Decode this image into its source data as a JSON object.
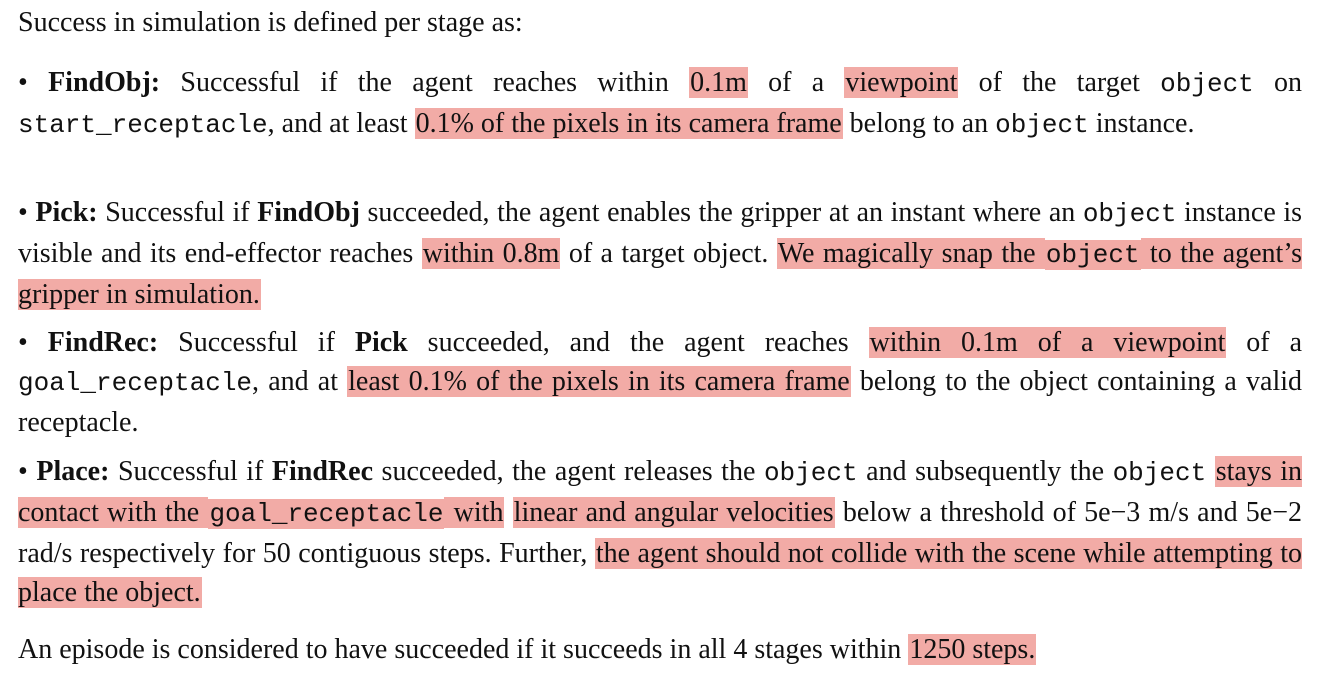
{
  "intro": "Success in simulation is defined per stage as:",
  "highlight_color": "#f2aba6",
  "stages": [
    {
      "name": "FindObj:",
      "segments": [
        {
          "t": "Successful if the agent reaches within "
        },
        {
          "t": "0.1m",
          "h": true
        },
        {
          "t": " of a "
        },
        {
          "t": "viewpoint",
          "h": true
        },
        {
          "t": " of the target "
        },
        {
          "t": "object",
          "m": true
        },
        {
          "t": " on "
        },
        {
          "t": "start_receptacle",
          "m": true
        },
        {
          "t": ", and at least "
        },
        {
          "t": "0.1% of the pixels in its camera frame",
          "h": true
        },
        {
          "t": " belong to an "
        },
        {
          "t": "object",
          "m": true
        },
        {
          "t": " instance."
        }
      ]
    },
    {
      "name": "Pick:",
      "segments": [
        {
          "t": "Successful if "
        },
        {
          "t": "FindObj",
          "b": true
        },
        {
          "t": " succeeded, the agent enables the gripper at an instant where an "
        },
        {
          "t": "object",
          "m": true
        },
        {
          "t": " instance is visible and its end-effector reaches "
        },
        {
          "t": "within 0.8m",
          "h": true
        },
        {
          "t": " of a target object. "
        },
        {
          "t": "We magically snap the ",
          "h": true
        },
        {
          "t": "object",
          "m": true,
          "h": true
        },
        {
          "t": " to the agent’s gripper in simulation.",
          "h": true
        }
      ]
    },
    {
      "name": "FindRec:",
      "segments": [
        {
          "t": "Successful if "
        },
        {
          "t": "Pick",
          "b": true
        },
        {
          "t": " succeeded, and the agent reaches "
        },
        {
          "t": "within 0.1m of a viewpoint",
          "h": true
        },
        {
          "t": " of a "
        },
        {
          "t": "goal_receptacle",
          "m": true
        },
        {
          "t": ", and at "
        },
        {
          "t": "least 0.1% of the pixels in its camera frame",
          "h": true
        },
        {
          "t": " belong to the object containing a valid receptacle."
        }
      ]
    },
    {
      "name": "Place:",
      "segments": [
        {
          "t": "Successful if "
        },
        {
          "t": "FindRec",
          "b": true
        },
        {
          "t": " succeeded, the agent releases the "
        },
        {
          "t": "object",
          "m": true
        },
        {
          "t": " and subsequently the "
        },
        {
          "t": "object",
          "m": true
        },
        {
          "t": " "
        },
        {
          "t": "stays in contact with the ",
          "h": true
        },
        {
          "t": "goal_receptacle",
          "m": true,
          "h": true
        },
        {
          "t": " with",
          "h": true
        },
        {
          "t": " "
        },
        {
          "t": "linear and angular velocities",
          "h": true
        },
        {
          "t": " below a threshold of 5e−3 m/s and 5e−2 rad/s respectively for 50 contiguous steps. Further, "
        },
        {
          "t": "the agent should not collide with the scene while attempting to place the object.",
          "h": true
        }
      ]
    }
  ],
  "conclusion": [
    {
      "t": "An episode is considered to have succeeded if it succeeds in all 4 stages within "
    },
    {
      "t": "1250 steps.",
      "h": true
    }
  ]
}
